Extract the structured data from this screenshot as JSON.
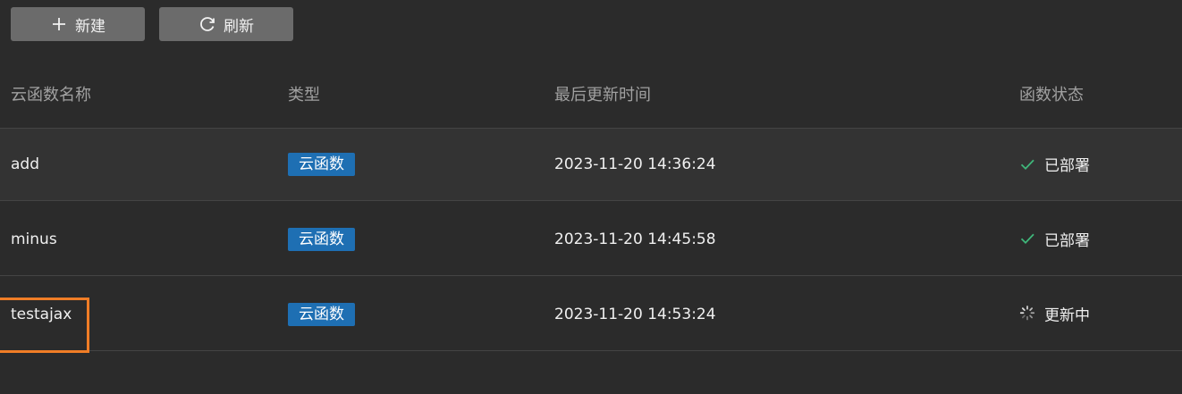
{
  "toolbar": {
    "new_label": "新建",
    "refresh_label": "刷新"
  },
  "table": {
    "columns": [
      "云函数名称",
      "类型",
      "最后更新时间",
      "函数状态"
    ],
    "rows": [
      {
        "name": "add",
        "type": "云函数",
        "updated": "2023-11-20 14:36:24",
        "status": "已部署",
        "status_icon": "check-icon"
      },
      {
        "name": "minus",
        "type": "云函数",
        "updated": "2023-11-20 14:45:58",
        "status": "已部署",
        "status_icon": "check-icon"
      },
      {
        "name": "testajax",
        "type": "云函数",
        "updated": "2023-11-20 14:53:24",
        "status": "更新中",
        "status_icon": "loading-spinner-icon"
      }
    ]
  },
  "colors": {
    "background": "#2b2b2b",
    "button": "#6b6b6b",
    "tag": "#1e6fb3",
    "success": "#3fb67a",
    "highlight": "#f07d26"
  }
}
